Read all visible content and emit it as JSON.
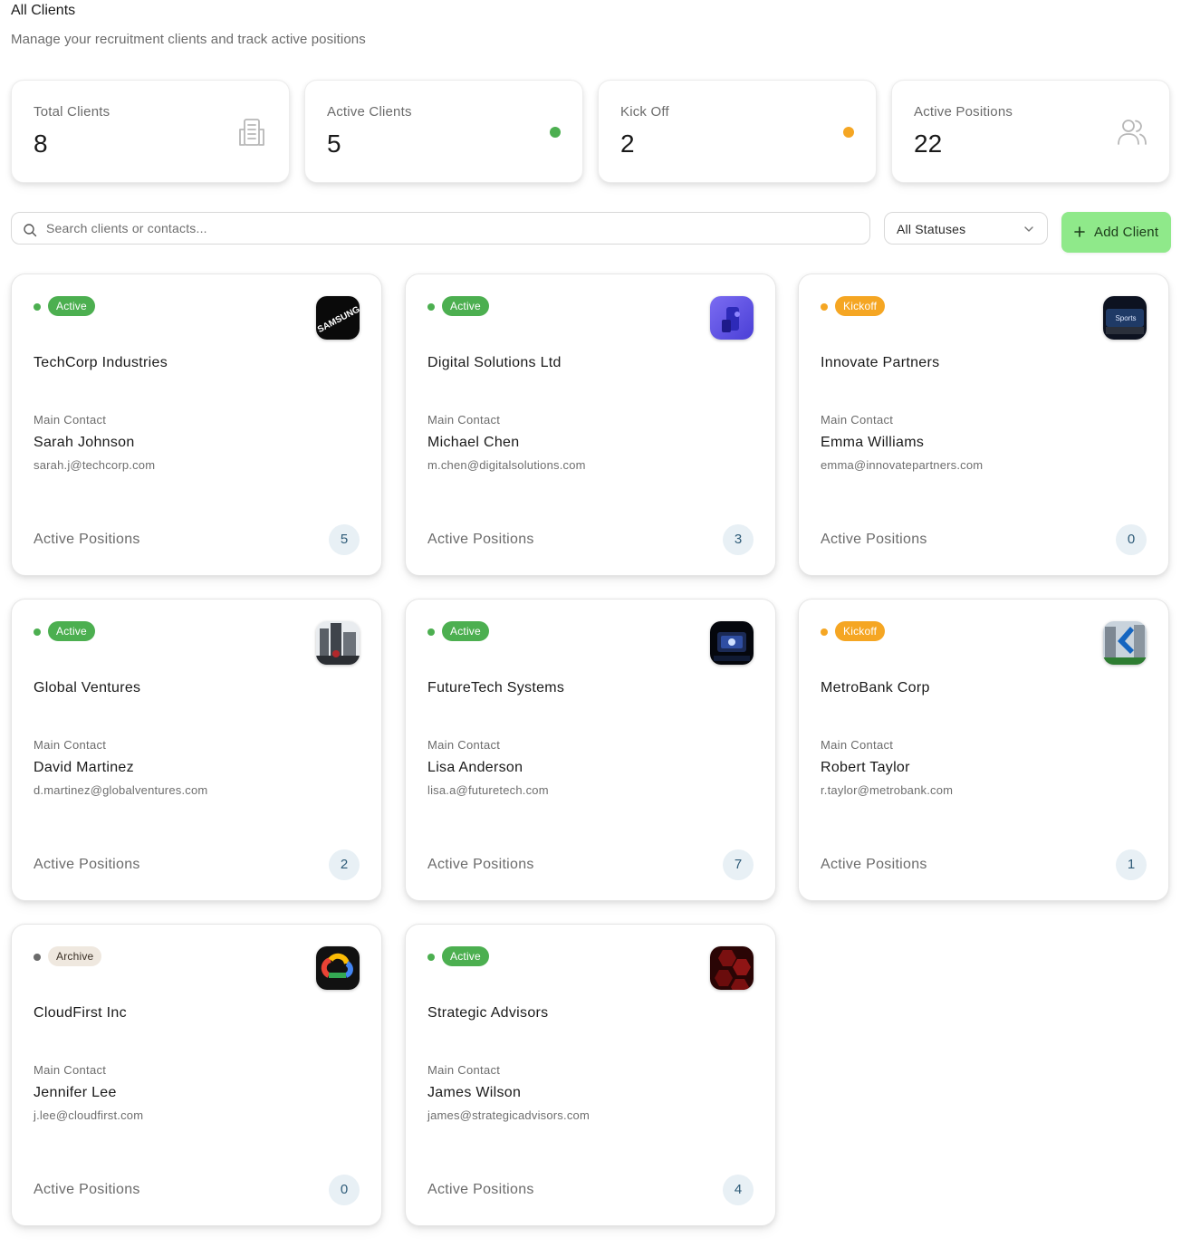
{
  "header": {
    "title": "All Clients",
    "subtitle": "Manage your recruitment clients and track active positions"
  },
  "stats": [
    {
      "label": "Total Clients",
      "value": "8",
      "icon": "building-icon"
    },
    {
      "label": "Active Clients",
      "value": "5",
      "indicator_color": "#4caf50"
    },
    {
      "label": "Kick Off",
      "value": "2",
      "indicator_color": "#f5a623"
    },
    {
      "label": "Active Positions",
      "value": "22",
      "icon": "users-icon"
    }
  ],
  "toolbar": {
    "search_placeholder": "Search clients or contacts...",
    "status_filter": "All Statuses",
    "add_label": "Add Client"
  },
  "colors": {
    "active": "#4caf50",
    "kickoff": "#f5a623",
    "archive_dot": "#6b6b6b",
    "archive_badge_bg": "#efe8df",
    "accent_button": "#8fe98a"
  },
  "common": {
    "main_contact_label": "Main Contact",
    "active_positions_label": "Active Positions"
  },
  "clients": [
    {
      "status": "Active",
      "name": "TechCorp Industries",
      "contact": "Sarah Johnson",
      "email": "sarah.j@techcorp.com",
      "positions": "5",
      "logo": "samsung-logo",
      "logo_text": "SAMSUNG"
    },
    {
      "status": "Active",
      "name": "Digital Solutions Ltd",
      "contact": "Michael Chen",
      "email": "m.chen@digitalsolutions.com",
      "positions": "3",
      "logo": "phone-logo"
    },
    {
      "status": "Kickoff",
      "name": "Innovate Partners",
      "contact": "Emma Williams",
      "email": "emma@innovatepartners.com",
      "positions": "0",
      "logo": "sports-logo",
      "logo_text": "Sports"
    },
    {
      "status": "Active",
      "name": "Global Ventures",
      "contact": "David Martinez",
      "email": "d.martinez@globalventures.com",
      "positions": "2",
      "logo": "city-photo-logo"
    },
    {
      "status": "Active",
      "name": "FutureTech Systems",
      "contact": "Lisa Anderson",
      "email": "lisa.a@futuretech.com",
      "positions": "7",
      "logo": "tech-screen-logo"
    },
    {
      "status": "Kickoff",
      "name": "MetroBank Corp",
      "contact": "Robert Taylor",
      "email": "r.taylor@metrobank.com",
      "positions": "1",
      "logo": "bank-building-logo"
    },
    {
      "status": "Archive",
      "name": "CloudFirst Inc",
      "contact": "Jennifer Lee",
      "email": "j.lee@cloudfirst.com",
      "positions": "0",
      "logo": "cloud-logo"
    },
    {
      "status": "Active",
      "name": "Strategic Advisors",
      "contact": "James Wilson",
      "email": "james@strategicadvisors.com",
      "positions": "4",
      "logo": "hexagon-pattern-logo"
    }
  ]
}
